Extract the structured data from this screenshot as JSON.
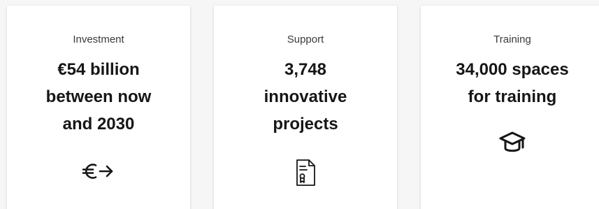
{
  "cards": [
    {
      "label": "Investment",
      "value_lines": [
        "€54 billion",
        "between now",
        "and 2030"
      ],
      "icon": "euro-arrow-icon"
    },
    {
      "label": "Support",
      "value_lines": [
        "3,748",
        "innovative",
        "projects"
      ],
      "icon": "certificate-document-icon"
    },
    {
      "label": "Training",
      "value_lines": [
        "34,000 spaces",
        "for training"
      ],
      "icon": "graduation-cap-icon"
    }
  ],
  "colors": {
    "text": "#161616",
    "label": "#3a3a3a",
    "card_background": "#ffffff",
    "page_background": "#f6f6f6"
  }
}
